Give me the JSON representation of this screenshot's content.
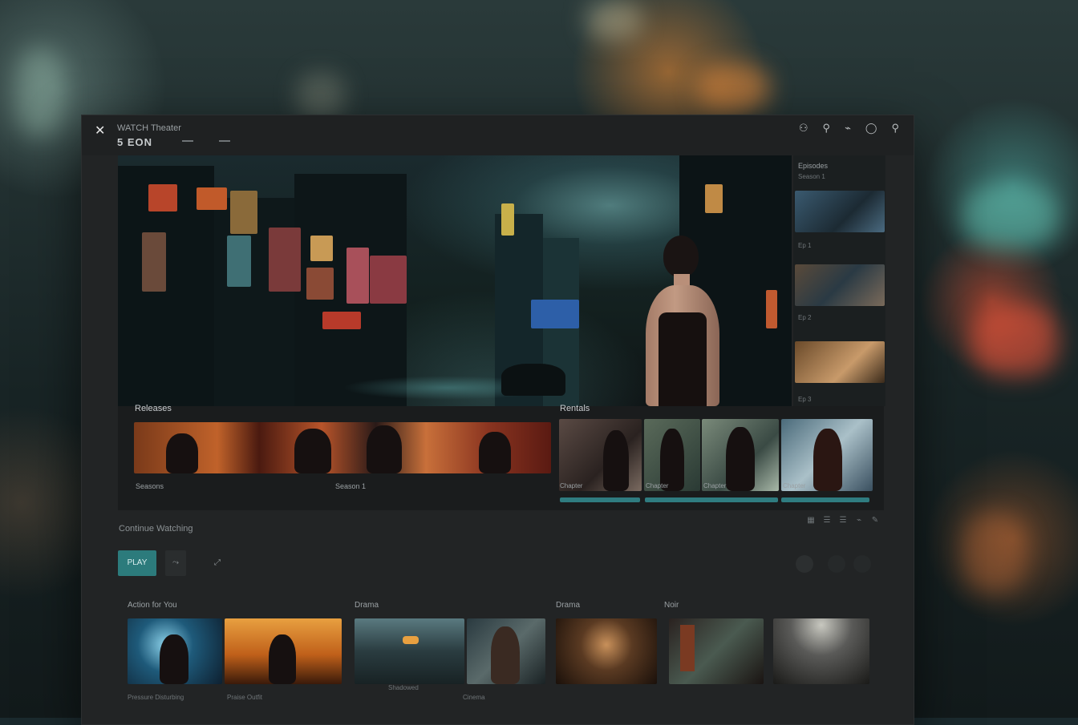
{
  "window": {
    "app_title": "WATCH Theater",
    "subtitle": "5 EON",
    "toolbar_icons": [
      "share-icon",
      "pin-icon",
      "cast-icon",
      "account-icon",
      "search-icon"
    ]
  },
  "side_panel": {
    "heading": "Episodes",
    "subheading": "Season 1",
    "items": [
      {
        "caption": "Ep 1"
      },
      {
        "caption": "Ep 2"
      },
      {
        "caption": "Ep 3"
      }
    ]
  },
  "rows": {
    "left": {
      "title": "Releases",
      "footer_left": "Seasons",
      "footer_right": "Season 1"
    },
    "right": {
      "title": "Rentals",
      "captions": [
        "Chapter",
        "Chapter",
        "Chapter",
        "Chapter"
      ]
    }
  },
  "continue": {
    "label": "Continue Watching",
    "play_label": "PLAY",
    "buttons": [
      "add-icon",
      "info-icon"
    ]
  },
  "categories": [
    {
      "title": "Action for You",
      "captions": [
        "Pressure Disturbing",
        "Praise Outfit"
      ]
    },
    {
      "title": "Drama",
      "captions": [
        "Shadowed",
        "Cinema"
      ]
    },
    {
      "title": "Drama"
    },
    {
      "title": "Noir"
    }
  ],
  "colors": {
    "accent": "#2c7b7c",
    "window": "#222425",
    "titlebar": "#1f2122"
  }
}
